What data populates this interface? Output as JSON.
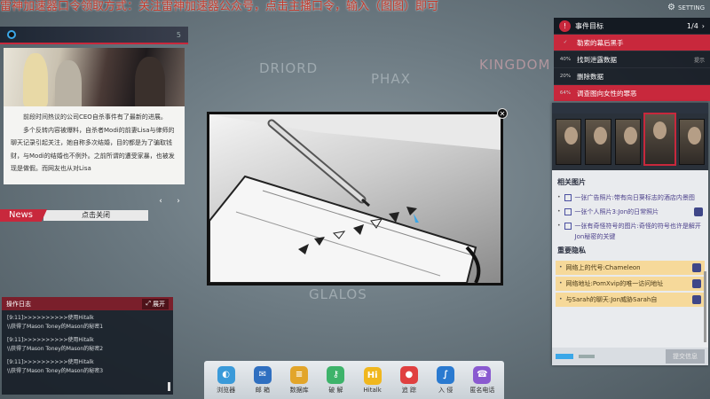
{
  "overlay": {
    "streamer_text": "雷神加速器口令领取方式：关注雷神加速器公众号，点击主播口令，输入（图图）即可",
    "settings_label": "SETTING"
  },
  "map": {
    "labels": [
      "DRIORD",
      "PHAX",
      "GLALOS",
      "KINGDOM"
    ]
  },
  "news": {
    "counter": "5",
    "paragraphs": [
      "前段时间热议的公司CEO自杀事件有了最新的进展。",
      "多个反转内容被爆料，自杀者Modi的前妻Lisa与律师的聊天记录引起关注，她自称多次结婚，目的都是为了骗取钱财，与Modi的结婚也不例外。之前所谓的遭受家暴，也被发现是做假。而网友也从对Lisa"
    ],
    "tag": "News",
    "close_label": "点击关闭",
    "prev_label": "‹",
    "next_label": "›"
  },
  "log": {
    "title": "操作日志",
    "expand_label": "展开",
    "entries": [
      {
        "line1": "[9:11]>>>>>>>>>>使用Hitalk",
        "line2": "\\\\获得了Mason Toney的Mason的秘密1"
      },
      {
        "line1": "[9:11]>>>>>>>>>>使用Hitalk",
        "line2": "\\\\获得了Mason Toney的Mason的秘密2"
      },
      {
        "line1": "[9:11]>>>>>>>>>>使用Hitalk",
        "line2": "\\\\获得了Mason Toney的Mason的秘密3"
      }
    ]
  },
  "goals": {
    "title": "事件目标",
    "progress": "1/4",
    "items": [
      {
        "pct": "✓",
        "label": "勒索的幕后黑手",
        "active": true,
        "hint": ""
      },
      {
        "pct": "40%",
        "label": "找到泄露数据",
        "active": false,
        "hint": "提示"
      },
      {
        "pct": "20%",
        "label": "删除数据",
        "active": false,
        "hint": ""
      },
      {
        "pct": "64%",
        "label": "调查图向女性的罪恶",
        "active": false,
        "hint": ""
      }
    ]
  },
  "evidence": {
    "section_images": "相关图片",
    "images": [
      {
        "text": "一张广告照片:带有向日葵标志的酒店内景图",
        "badge": false
      },
      {
        "text": "一张个人照片3:Jon的日常照片",
        "badge": true
      },
      {
        "text": "一张有奇怪符号的图片:奇怪的符号也许是解开Jon秘密的关键",
        "badge": false
      }
    ],
    "section_privacy": "重要隐私",
    "privacy": [
      {
        "text": "网络上的代号:Chameleon",
        "badge": true
      },
      {
        "text": "网络地址:PomXvip的唯一访问地址",
        "badge": true
      },
      {
        "text": "与Sarah的聊天:Jon威胁Sarah自",
        "badge": true
      }
    ],
    "submit_label": "提交信息"
  },
  "dock": {
    "apps": [
      {
        "label": "浏览器",
        "icon": "browser-icon",
        "color": "#3a9ad9",
        "glyph": "◐"
      },
      {
        "label": "邮 箱",
        "icon": "mail-icon",
        "color": "#2f6fc0",
        "glyph": "✉"
      },
      {
        "label": "数据库",
        "icon": "database-icon",
        "color": "#e2a52a",
        "glyph": "≡"
      },
      {
        "label": "破 解",
        "icon": "crack-icon",
        "color": "#3db36a",
        "glyph": "⚷"
      },
      {
        "label": "Hitalk",
        "icon": "hitalk-icon",
        "color": "#f0b71e",
        "glyph": "Hi"
      },
      {
        "label": "追 踪",
        "icon": "track-icon",
        "color": "#e04040",
        "glyph": "●"
      },
      {
        "label": "入 侵",
        "icon": "hack-icon",
        "color": "#2a7ad0",
        "glyph": "∫"
      },
      {
        "label": "匿名电话",
        "icon": "phone-icon",
        "color": "#8a5ad0",
        "glyph": "☎"
      }
    ]
  }
}
